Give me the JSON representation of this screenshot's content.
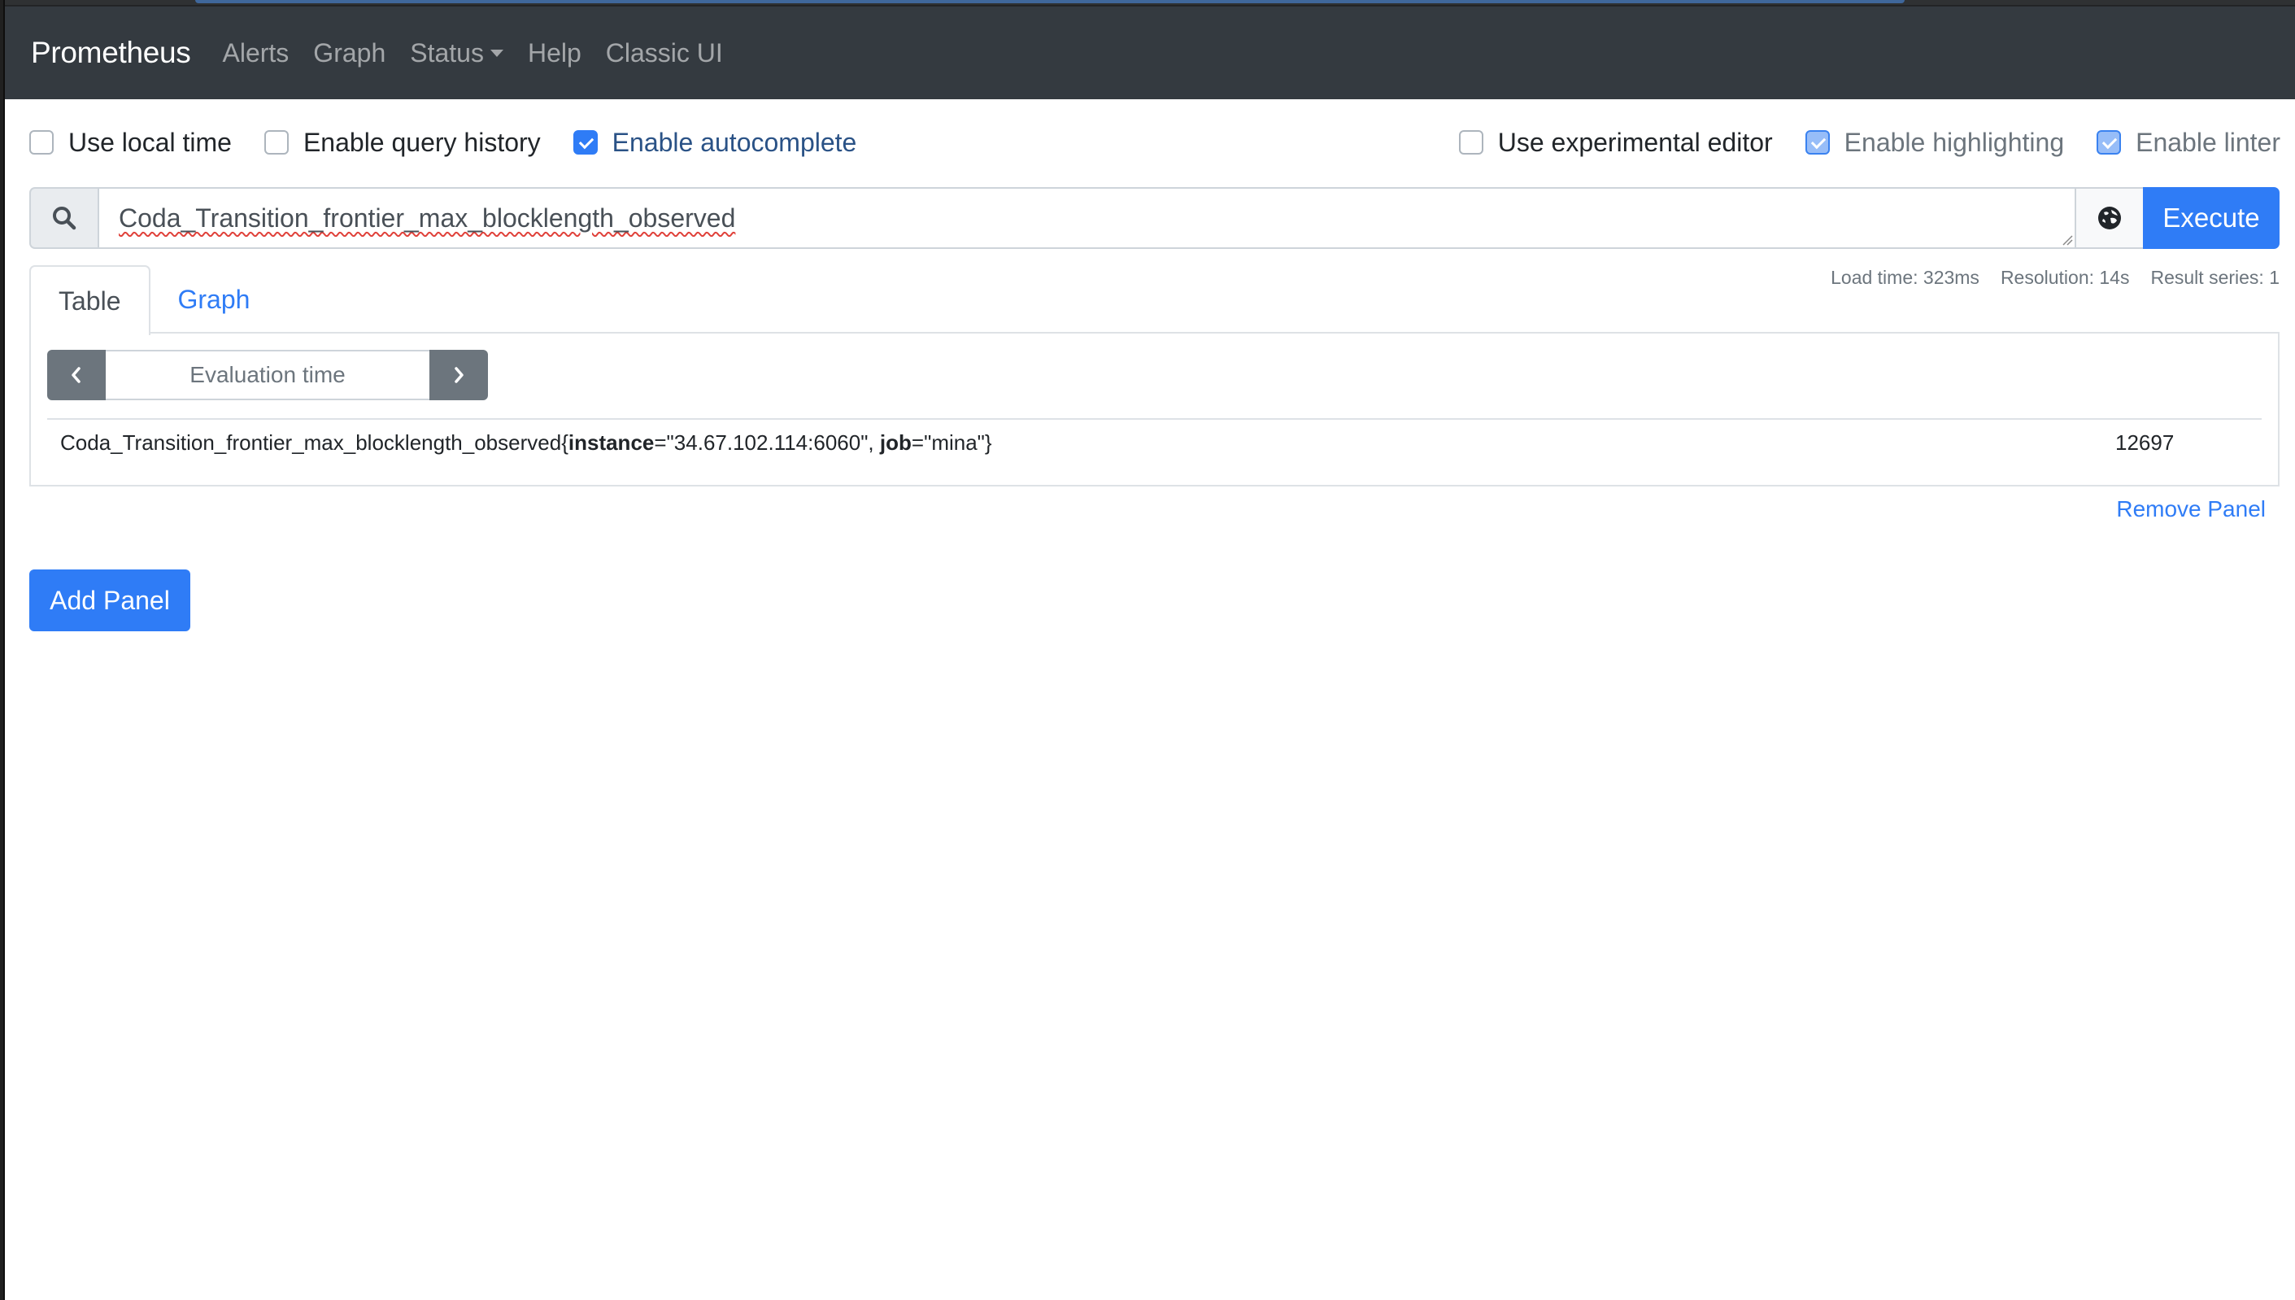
{
  "navbar": {
    "brand": "Prometheus",
    "links": [
      {
        "label": "Alerts"
      },
      {
        "label": "Graph"
      },
      {
        "label": "Status",
        "dropdown": true
      },
      {
        "label": "Help"
      },
      {
        "label": "Classic UI"
      }
    ]
  },
  "options": {
    "left": [
      {
        "label": "Use local time",
        "checked": false,
        "disabled": false
      },
      {
        "label": "Enable query history",
        "checked": false,
        "disabled": false
      },
      {
        "label": "Enable autocomplete",
        "checked": true,
        "disabled": false
      }
    ],
    "right": [
      {
        "label": "Use experimental editor",
        "checked": false,
        "disabled": false
      },
      {
        "label": "Enable highlighting",
        "checked": true,
        "disabled": true
      },
      {
        "label": "Enable linter",
        "checked": true,
        "disabled": true
      }
    ]
  },
  "query": {
    "search_icon": "search-icon",
    "expression": "Coda_Transition_frontier_max_blocklength_observed",
    "metrics_explorer_icon": "globe-icon",
    "execute_label": "Execute"
  },
  "stats": {
    "load_time": "Load time: 323ms",
    "resolution": "Resolution: 14s",
    "result_series": "Result series: 1"
  },
  "tabs": [
    {
      "label": "Table",
      "active": true
    },
    {
      "label": "Graph",
      "active": false
    }
  ],
  "table_view": {
    "eval_time_placeholder": "Evaluation time",
    "prev_icon": "chevron-left-icon",
    "next_icon": "chevron-right-icon",
    "rows": [
      {
        "metric": "Coda_Transition_frontier_max_blocklength_observed",
        "labels": [
          {
            "name": "instance",
            "value": "34.67.102.114:6060"
          },
          {
            "name": "job",
            "value": "mina"
          }
        ],
        "value": "12697"
      }
    ]
  },
  "panel_actions": {
    "remove_label": "Remove Panel",
    "add_label": "Add Panel"
  },
  "colors": {
    "navbar_bg": "#343a40",
    "primary": "#2f7cf6",
    "secondary": "#6c757d"
  }
}
